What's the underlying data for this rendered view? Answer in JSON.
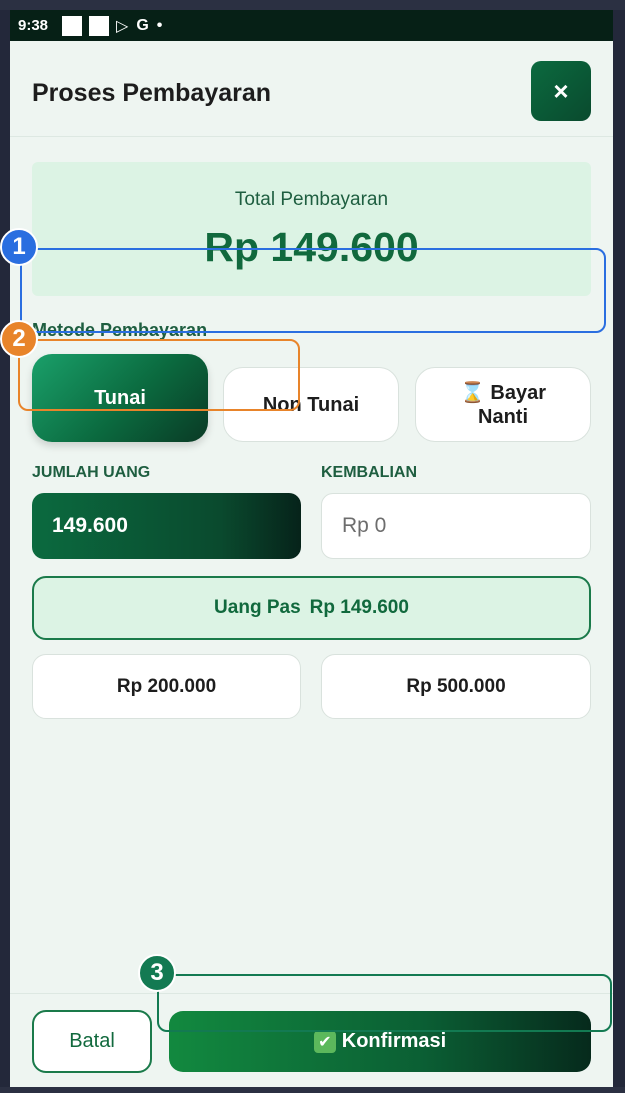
{
  "status_bar": {
    "time": "9:38",
    "icons": [
      "notification-square",
      "notification-square",
      "play-store-icon",
      "google-icon",
      "dot"
    ]
  },
  "header": {
    "title": "Proses Pembayaran",
    "close_label": "×"
  },
  "total": {
    "label": "Total Pembayaran",
    "amount": "Rp 149.600"
  },
  "payment_method": {
    "label": "Metode Pembayaran",
    "options": [
      {
        "label": "Tunai",
        "selected": true
      },
      {
        "label": "Non Tunai",
        "selected": false
      },
      {
        "label": "⌛ Bayar Nanti",
        "selected": false
      }
    ]
  },
  "cash": {
    "amount_label": "JUMLAH UANG",
    "amount_value": "149.600",
    "change_label": "KEMBALIAN",
    "change_value": "Rp 0"
  },
  "quick_amounts": {
    "exact_label": "Uang Pas",
    "exact_value": "Rp 149.600",
    "options": [
      "Rp 200.000",
      "Rp 500.000"
    ]
  },
  "footer": {
    "cancel_label": "Batal",
    "confirm_label": "Konfirmasi",
    "confirm_icon": "✔"
  },
  "annotations": [
    {
      "number": "1",
      "color": "#2a6ee0"
    },
    {
      "number": "2",
      "color": "#e8842a"
    },
    {
      "number": "3",
      "color": "#137a52"
    }
  ]
}
